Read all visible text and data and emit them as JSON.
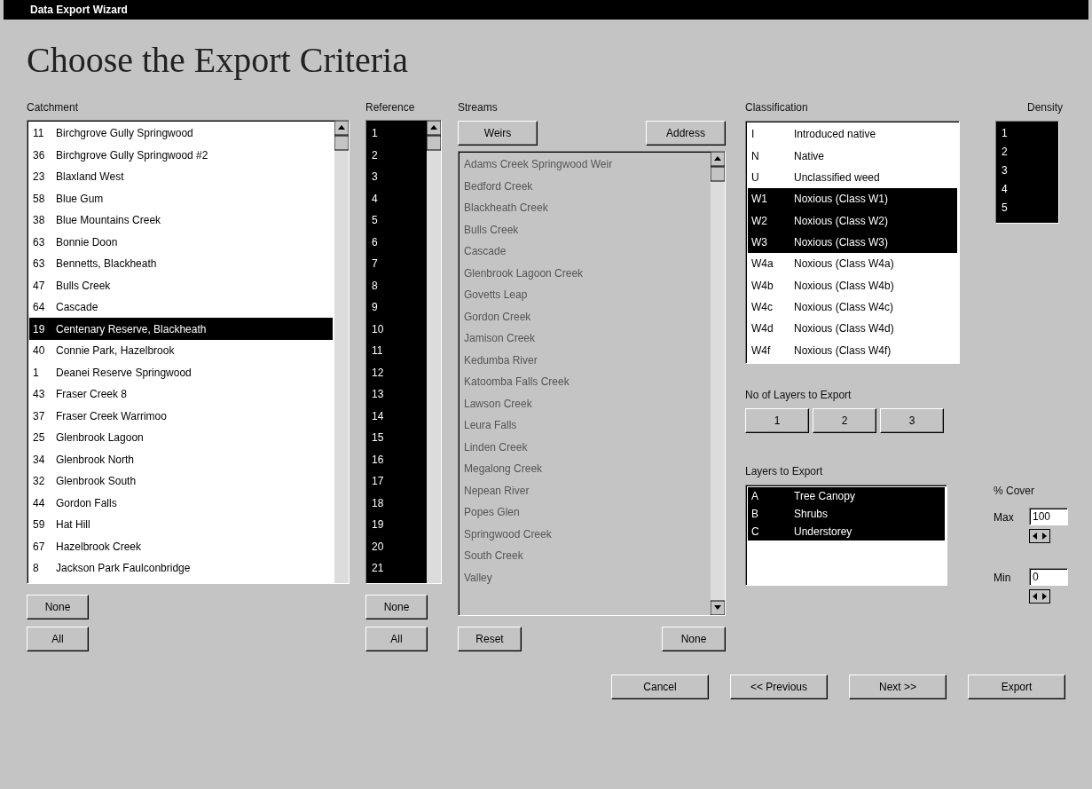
{
  "window": {
    "title": "Data Export Wizard"
  },
  "heading": "Choose the Export Criteria",
  "catchment": {
    "label": "Catchment",
    "items": [
      {
        "code": "11",
        "name": "Birchgrove Gully Springwood",
        "selected": false
      },
      {
        "code": "36",
        "name": "Birchgrove Gully Springwood #2",
        "selected": false
      },
      {
        "code": "23",
        "name": "Blaxland West",
        "selected": false
      },
      {
        "code": "58",
        "name": "Blue Gum",
        "selected": false
      },
      {
        "code": "38",
        "name": "Blue Mountains Creek",
        "selected": false
      },
      {
        "code": "63",
        "name": "Bonnie Doon",
        "selected": false
      },
      {
        "code": "63",
        "name": "Bennetts, Blackheath",
        "selected": false
      },
      {
        "code": "47",
        "name": "Bulls Creek",
        "selected": false
      },
      {
        "code": "64",
        "name": "Cascade",
        "selected": false
      },
      {
        "code": "19",
        "name": "Centenary Reserve, Blackheath",
        "selected": true
      },
      {
        "code": "40",
        "name": "Connie Park, Hazelbrook",
        "selected": false
      },
      {
        "code": "1",
        "name": "Deanei Reserve Springwood",
        "selected": false
      },
      {
        "code": "43",
        "name": "Fraser Creek 8",
        "selected": false
      },
      {
        "code": "37",
        "name": "Fraser Creek Warrimoo",
        "selected": false
      },
      {
        "code": "25",
        "name": "Glenbrook Lagoon",
        "selected": false
      },
      {
        "code": "34",
        "name": "Glenbrook North",
        "selected": false
      },
      {
        "code": "32",
        "name": "Glenbrook South",
        "selected": false
      },
      {
        "code": "44",
        "name": "Gordon Falls",
        "selected": false
      },
      {
        "code": "59",
        "name": "Hat Hill",
        "selected": false
      },
      {
        "code": "67",
        "name": "Hazelbrook Creek",
        "selected": false
      },
      {
        "code": "8",
        "name": "Jackson Park Faulconbridge",
        "selected": false
      }
    ],
    "buttons": [
      "None",
      "All"
    ]
  },
  "reference": {
    "label": "Reference",
    "items": [
      {
        "text": "1",
        "selected": true
      },
      {
        "text": "2",
        "selected": true
      },
      {
        "text": "3",
        "selected": true
      },
      {
        "text": "4",
        "selected": true
      },
      {
        "text": "5",
        "selected": true
      },
      {
        "text": "6",
        "selected": true
      },
      {
        "text": "7",
        "selected": true
      },
      {
        "text": "8",
        "selected": true
      },
      {
        "text": "9",
        "selected": true
      },
      {
        "text": "10",
        "selected": true
      },
      {
        "text": "11",
        "selected": true
      },
      {
        "text": "12",
        "selected": true
      },
      {
        "text": "13",
        "selected": true
      },
      {
        "text": "14",
        "selected": true
      },
      {
        "text": "15",
        "selected": true
      },
      {
        "text": "16",
        "selected": true
      },
      {
        "text": "17",
        "selected": true
      },
      {
        "text": "18",
        "selected": true
      },
      {
        "text": "19",
        "selected": true
      },
      {
        "text": "20",
        "selected": true
      },
      {
        "text": "21",
        "selected": true
      }
    ],
    "buttons": [
      "None",
      "All"
    ]
  },
  "streams": {
    "label": "Streams",
    "disabled": true,
    "top_buttons": [
      "Weirs",
      "Address"
    ],
    "items": [
      "Adams Creek Springwood Weir",
      "Bedford Creek",
      "Blackheath Creek",
      "Bulls Creek",
      "Cascade",
      "Glenbrook Lagoon Creek",
      "Govetts Leap",
      "Gordon Creek",
      "Jamison Creek",
      "Kedumba River",
      "Katoomba Falls Creek",
      "Lawson Creek",
      "Leura Falls",
      "Linden Creek",
      "Megalong Creek",
      "Nepean River",
      "Popes Glen",
      "Springwood Creek",
      "South Creek",
      "Valley"
    ],
    "buttons": [
      "Reset",
      "None"
    ]
  },
  "classification": {
    "label": "Classification",
    "items": [
      {
        "code": "I",
        "name": "Introduced native",
        "selected": false
      },
      {
        "code": "N",
        "name": "Native",
        "selected": false
      },
      {
        "code": "U",
        "name": "Unclassified weed",
        "selected": false
      },
      {
        "code": "W1",
        "name": "Noxious (Class W1)",
        "selected": true
      },
      {
        "code": "W2",
        "name": "Noxious (Class W2)",
        "selected": true
      },
      {
        "code": "W3",
        "name": "Noxious (Class W3)",
        "selected": true
      },
      {
        "code": "W4a",
        "name": "Noxious (Class W4a)",
        "selected": false
      },
      {
        "code": "W4b",
        "name": "Noxious (Class W4b)",
        "selected": false
      },
      {
        "code": "W4c",
        "name": "Noxious (Class W4c)",
        "selected": false
      },
      {
        "code": "W4d",
        "name": "Noxious (Class W4d)",
        "selected": false
      },
      {
        "code": "W4f",
        "name": "Noxious (Class W4f)",
        "selected": false
      }
    ]
  },
  "density": {
    "label": "Density",
    "items": [
      {
        "text": "1",
        "selected": true
      },
      {
        "text": "2",
        "selected": true
      },
      {
        "text": "3",
        "selected": true
      },
      {
        "text": "4",
        "selected": true
      },
      {
        "text": "5",
        "selected": true
      }
    ]
  },
  "layer_count": {
    "label": "No of Layers to Export",
    "options": [
      {
        "text": "1",
        "selected": false
      },
      {
        "text": "2",
        "selected": false
      },
      {
        "text": "3",
        "selected": false
      }
    ]
  },
  "layers": {
    "label": "Layers to Export",
    "items": [
      {
        "code": "A",
        "name": "Tree Canopy",
        "selected": true
      },
      {
        "code": "B",
        "name": "Shrubs",
        "selected": true
      },
      {
        "code": "C",
        "name": "Understorey",
        "selected": true
      }
    ]
  },
  "cover": {
    "label": "% Cover",
    "max": {
      "label": "Max",
      "value": "100"
    },
    "min": {
      "label": "Min",
      "value": "0"
    }
  },
  "footer_buttons": [
    "Cancel",
    "<< Previous",
    "Next >>",
    "Export"
  ]
}
